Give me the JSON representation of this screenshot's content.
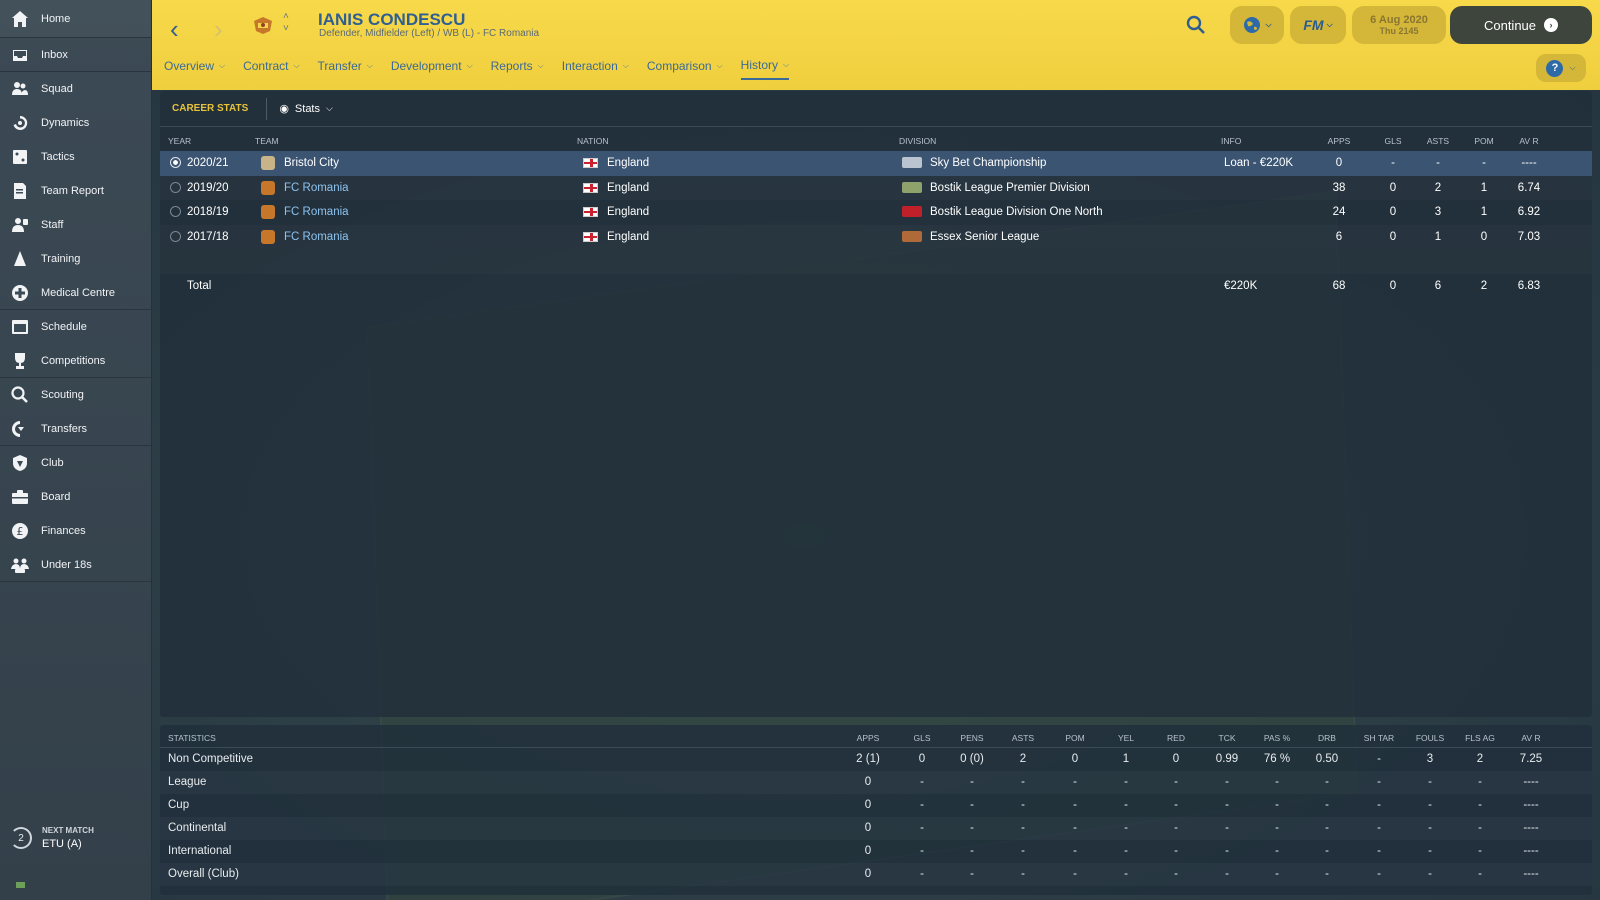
{
  "sidebar": {
    "items": [
      {
        "label": "Home",
        "icon": "home-icon"
      },
      {
        "label": "Inbox",
        "icon": "inbox-icon"
      },
      {
        "label": "Squad",
        "icon": "squad-icon"
      },
      {
        "label": "Dynamics",
        "icon": "dynamics-icon"
      },
      {
        "label": "Tactics",
        "icon": "tactics-icon"
      },
      {
        "label": "Team Report",
        "icon": "team-report-icon"
      },
      {
        "label": "Staff",
        "icon": "staff-icon"
      },
      {
        "label": "Training",
        "icon": "training-icon"
      },
      {
        "label": "Medical Centre",
        "icon": "medical-icon"
      },
      {
        "label": "Schedule",
        "icon": "schedule-icon"
      },
      {
        "label": "Competitions",
        "icon": "trophy-icon"
      },
      {
        "label": "Scouting",
        "icon": "scouting-icon"
      },
      {
        "label": "Transfers",
        "icon": "transfers-icon"
      },
      {
        "label": "Club",
        "icon": "club-icon"
      },
      {
        "label": "Board",
        "icon": "board-icon"
      },
      {
        "label": "Finances",
        "icon": "finances-icon"
      },
      {
        "label": "Under 18s",
        "icon": "under18-icon"
      }
    ],
    "next_match": {
      "label": "NEXT MATCH",
      "value": "ETU (A)",
      "days": "2"
    }
  },
  "header": {
    "player_name": "IANIS CONDESCU",
    "player_sub": "Defender, Midfielder (Left) / WB (L) - FC Romania",
    "date": "6 Aug 2020",
    "time": "Thu 2145",
    "continue_label": "Continue",
    "help_label": "?",
    "fm_label": "FM",
    "tabs": [
      {
        "label": "Overview"
      },
      {
        "label": "Contract"
      },
      {
        "label": "Transfer"
      },
      {
        "label": "Development"
      },
      {
        "label": "Reports"
      },
      {
        "label": "Interaction"
      },
      {
        "label": "Comparison"
      },
      {
        "label": "History"
      }
    ],
    "active_tab": "History"
  },
  "career": {
    "title": "CAREER STATS",
    "view_label": "Stats",
    "columns": [
      "YEAR",
      "TEAM",
      "NATION",
      "DIVISION",
      "INFO",
      "APPS",
      "GLS",
      "ASTS",
      "POM",
      "AV R"
    ],
    "rows": [
      {
        "year": "2020/21",
        "team": "Bristol City",
        "nation": "England",
        "division": "Sky Bet Championship",
        "info": "Loan - €220K",
        "apps": "0",
        "gls": "-",
        "asts": "-",
        "pom": "-",
        "avr": "----"
      },
      {
        "year": "2019/20",
        "team": "FC Romania",
        "nation": "England",
        "division": "Bostik League Premier Division",
        "info": "",
        "apps": "38",
        "gls": "0",
        "asts": "2",
        "pom": "1",
        "avr": "6.74"
      },
      {
        "year": "2018/19",
        "team": "FC Romania",
        "nation": "England",
        "division": "Bostik League Division One North",
        "info": "",
        "apps": "24",
        "gls": "0",
        "asts": "3",
        "pom": "1",
        "avr": "6.92"
      },
      {
        "year": "2017/18",
        "team": "FC Romania",
        "nation": "England",
        "division": "Essex Senior League",
        "info": "",
        "apps": "6",
        "gls": "0",
        "asts": "1",
        "pom": "0",
        "avr": "7.03"
      }
    ],
    "total": {
      "label": "Total",
      "info": "€220K",
      "apps": "68",
      "gls": "0",
      "asts": "6",
      "pom": "2",
      "avr": "6.83"
    }
  },
  "statistics": {
    "columns": [
      "STATISTICS",
      "APPS",
      "GLS",
      "PENS",
      "ASTS",
      "POM",
      "YEL",
      "RED",
      "TCK",
      "PAS %",
      "DRB",
      "SH TAR",
      "FOULS",
      "FLS AG",
      "AV R"
    ],
    "rows": [
      {
        "name": "Non Competitive",
        "values": [
          "2 (1)",
          "0",
          "0 (0)",
          "2",
          "0",
          "1",
          "0",
          "0.99",
          "76 %",
          "0.50",
          "-",
          "3",
          "2",
          "7.25"
        ]
      },
      {
        "name": "League",
        "values": [
          "0",
          "-",
          "-",
          "-",
          "-",
          "-",
          "-",
          "-",
          "-",
          "-",
          "-",
          "-",
          "-",
          "----"
        ]
      },
      {
        "name": "Cup",
        "values": [
          "0",
          "-",
          "-",
          "-",
          "-",
          "-",
          "-",
          "-",
          "-",
          "-",
          "-",
          "-",
          "-",
          "----"
        ]
      },
      {
        "name": "Continental",
        "values": [
          "0",
          "-",
          "-",
          "-",
          "-",
          "-",
          "-",
          "-",
          "-",
          "-",
          "-",
          "-",
          "-",
          "----"
        ]
      },
      {
        "name": "International",
        "values": [
          "0",
          "-",
          "-",
          "-",
          "-",
          "-",
          "-",
          "-",
          "-",
          "-",
          "-",
          "-",
          "-",
          "----"
        ]
      },
      {
        "name": "Overall (Club)",
        "values": [
          "0",
          "-",
          "-",
          "-",
          "-",
          "-",
          "-",
          "-",
          "-",
          "-",
          "-",
          "-",
          "-",
          "----"
        ]
      }
    ]
  },
  "colors": {
    "header_yellow": "#f0cf3e",
    "accent_blue": "#2f5f92",
    "career_title": "#e7c23a",
    "selected_row": "#3b5472",
    "link": "#8cc2ee"
  }
}
